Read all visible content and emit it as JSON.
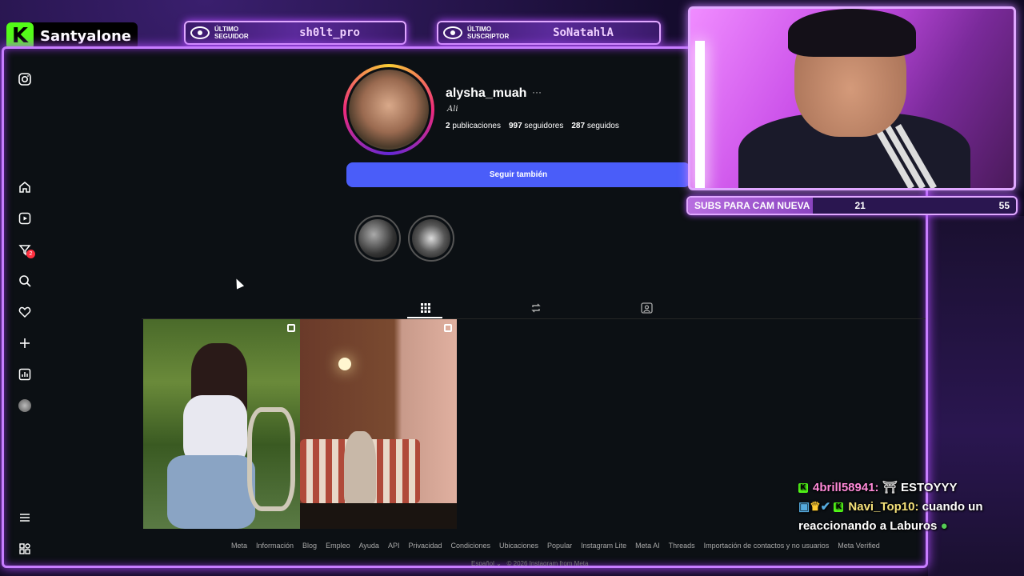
{
  "stream": {
    "channel_logo": "K",
    "channel_name": "Santyalone",
    "last_follower_label": "ÚLTIMO SEGUIDOR",
    "last_follower": "sh0lt_pro",
    "last_subscriber_label": "ÚLTIMO SUSCRIPTOR",
    "last_subscriber": "SoNatahlA",
    "subs_goal_label": "SUBS PARA CAM NUEVA",
    "subs_current": "21",
    "subs_target": "55",
    "subs_progress_fraction": 0.38
  },
  "instagram": {
    "sidebar": {
      "icons": [
        "instagram-icon",
        "home-icon",
        "reels-icon",
        "messages-icon",
        "search-icon",
        "heart-icon",
        "plus-icon",
        "dashboard-icon",
        "avatar",
        "menu-icon",
        "more-apps-icon"
      ],
      "messages_badge": "2"
    },
    "profile": {
      "username": "alysha_muah",
      "more": "···",
      "full_name": "Ali",
      "posts_count": "2",
      "posts_label": "publicaciones",
      "followers_count": "997",
      "followers_label": "seguidores",
      "following_count": "287",
      "following_label": "seguidos",
      "follow_button": "Seguir también"
    },
    "tabs": [
      "grid-icon",
      "reposts-icon",
      "tagged-icon"
    ],
    "footer": {
      "links": [
        "Meta",
        "Información",
        "Blog",
        "Empleo",
        "Ayuda",
        "API",
        "Privacidad",
        "Condiciones",
        "Ubicaciones",
        "Popular",
        "Instagram Lite",
        "Meta AI",
        "Threads",
        "Importación de contactos y no usuarios",
        "Meta Verified"
      ],
      "language": "Español",
      "copyright": "© 2026 Instagram from Meta"
    }
  },
  "chat": {
    "messages": [
      {
        "user": "4brill58941:",
        "text": "ESTOYYY"
      },
      {
        "user": "Navi_Top10:",
        "text": "cuando un reaccionando a Laburos"
      }
    ]
  },
  "colors": {
    "accent_purple": "#c77dff",
    "follow_blue": "#4a5df9",
    "kick_green": "#53fc18"
  }
}
